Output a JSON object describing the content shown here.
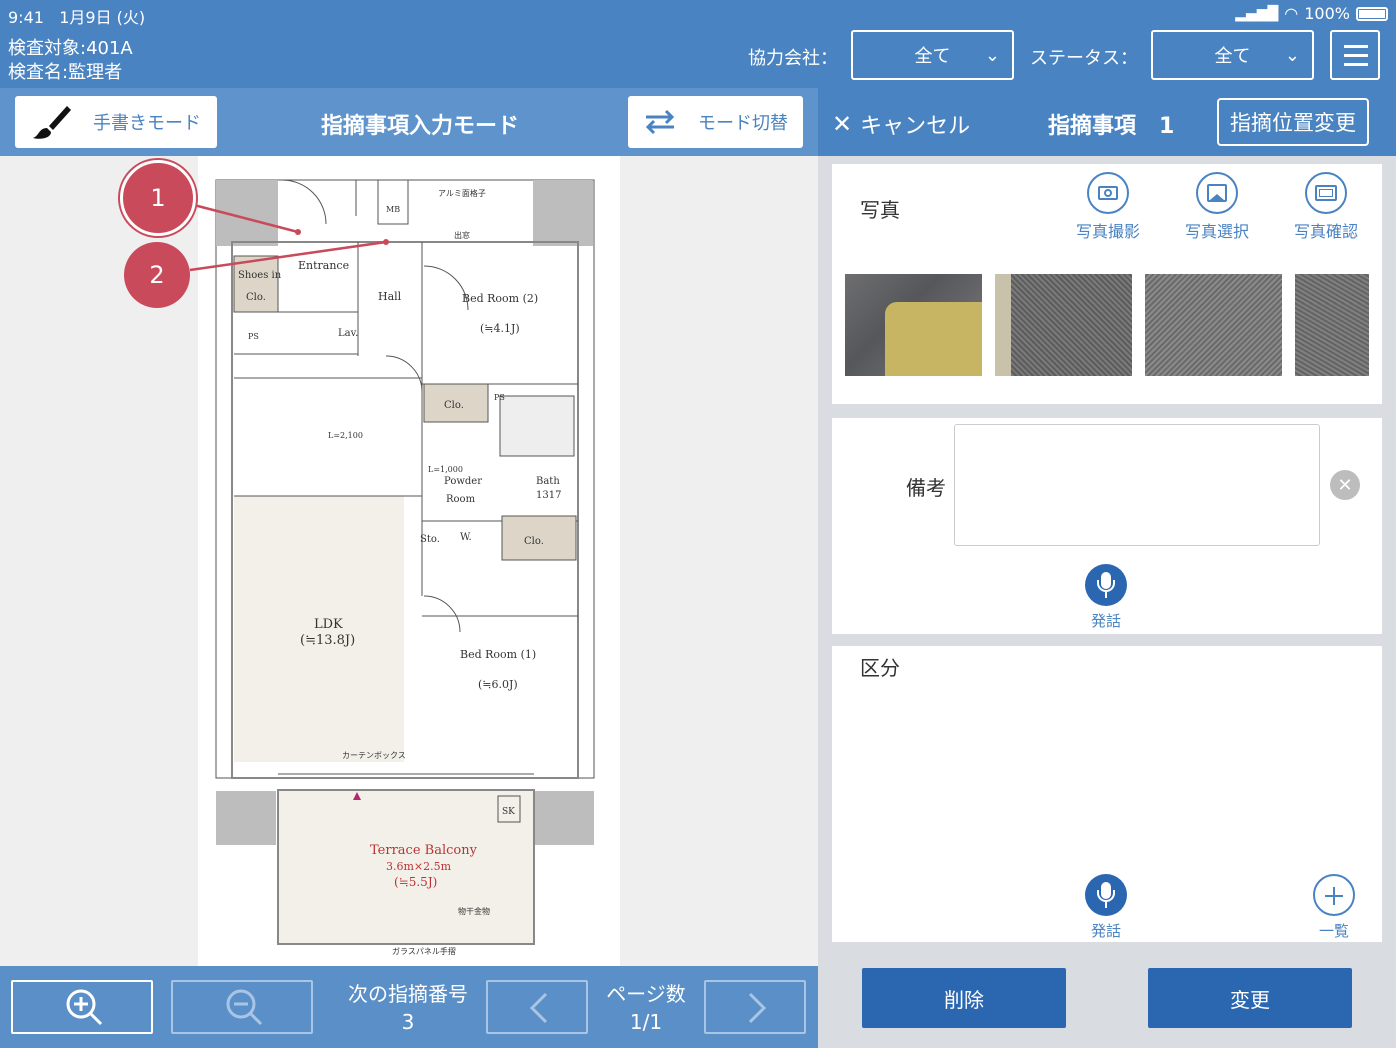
{
  "status_bar": {
    "time": "9:41",
    "date": "1月9日 (火)",
    "battery": "100%"
  },
  "header": {
    "inspection_target": "検査対象:401A",
    "inspection_name": "検査名:監理者",
    "partner_label": "協力会社：",
    "partner_value": "全て",
    "status_label": "ステータス：",
    "status_value": "全て"
  },
  "left_toolbar": {
    "handwriting_label": "手書きモード",
    "mode_title": "指摘事項入力モード",
    "switch_label": "モード切替"
  },
  "markers": [
    {
      "number": "1"
    },
    {
      "number": "2"
    }
  ],
  "floor_plan": {
    "rooms": [
      "Entrance",
      "Shoes in Clo.",
      "Hall",
      "Lav.",
      "Bed Room (2)",
      "(≒4.1J)",
      "Clo.",
      "Powder Room",
      "Bath 1317",
      "Sto.",
      "W.",
      "Clo.",
      "LDK",
      "(≒13.8J)",
      "Bed Room (1)",
      "(≒6.0J)",
      "Terrace Balcony",
      "3.6m×2.5m",
      "(≒5.5J)",
      "MB",
      "PS",
      "SK",
      "L=2,100",
      "L=1,000",
      "アルミ面格子",
      "出窓",
      "カーテンボックス",
      "物干金物",
      "ガラスパネル手摺"
    ]
  },
  "left_bottom": {
    "next_label": "次の指摘番号",
    "next_value": "3",
    "page_label": "ページ数",
    "page_value": "1/1"
  },
  "right_header": {
    "cancel_label": "キャンセル",
    "item_label": "指摘事項",
    "item_number": "1",
    "change_position_label": "指摘位置変更"
  },
  "photo_section": {
    "label": "写真",
    "take_label": "写真撮影",
    "select_label": "写真選択",
    "confirm_label": "写真確認"
  },
  "notes_section": {
    "label": "備考",
    "value": "",
    "mic_label": "発話"
  },
  "category_section": {
    "label": "区分",
    "mic_label": "発話",
    "list_label": "一覧"
  },
  "actions": {
    "delete_label": "削除",
    "change_label": "変更"
  }
}
